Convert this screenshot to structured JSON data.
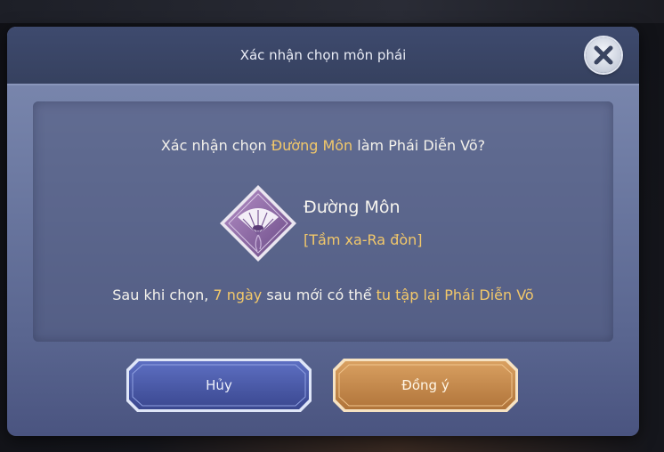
{
  "dialog": {
    "title": "Xác nhận chọn môn phái",
    "question": {
      "prefix": "Xác nhận chọn ",
      "highlight": "Đường Môn",
      "suffix": " làm Phái Diễn Võ?"
    },
    "sect": {
      "name": "Đường Môn",
      "tag": "[Tầm xa-Ra đòn]",
      "emblem_icon": "fan-emblem-icon"
    },
    "note": {
      "part1": "Sau khi chọn, ",
      "highlight1": "7 ngày",
      "part2": " sau mới có thể ",
      "highlight2": "tu tập lại Phái Diễn Võ"
    },
    "buttons": {
      "cancel_label": "Hủy",
      "confirm_label": "Đồng ý"
    },
    "close_icon": "close-icon"
  },
  "colors": {
    "highlight": "#f2c86a",
    "cancel_button": "#4a5aa6",
    "confirm_button": "#c88a4a"
  }
}
